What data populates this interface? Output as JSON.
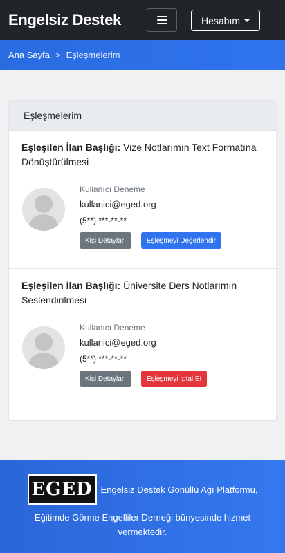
{
  "navbar": {
    "brand": "Engelsiz Destek",
    "menu_icon": "hamburger-icon",
    "account_label": "Hesabım",
    "account_icon": "caret-down-icon"
  },
  "breadcrumb": {
    "home": "Ana Sayfa",
    "separator": ">",
    "current": "Eşleşmelerim"
  },
  "card": {
    "header": "Eşleşmelerim",
    "matches": [
      {
        "title_label": "Eşleşilen İlan Başlığı:",
        "title_value": "Vize Notlarımın Text Formatına Dönüştürülmesi",
        "name": "Kullanıcı Deneme",
        "email": "kullanici@eged.org",
        "phone": "(5**) ***-**-**",
        "details_button": "Kişi Detayları",
        "action_button": "Eşleşmeyi Değerlendir",
        "action_color": "#2f74ee"
      },
      {
        "title_label": "Eşleşilen İlan Başlığı:",
        "title_value": "Üniversite Ders Notlarımın Seslendirilmesi",
        "name": "Kullanıcı Deneme",
        "email": "kullanici@eged.org",
        "phone": "(5**) ***-**-**",
        "details_button": "Kişi Detayları",
        "action_button": "Eşleşmeyi İptal Et",
        "action_color": "#e4353a"
      }
    ]
  },
  "footer": {
    "logo_text": "EGED",
    "line1": "Engelsiz Destek Gönüllü Ağı Platformu,",
    "line2": "Eğitimde Görme Engelliler Derneği bünyesinde hizmet vermektedir."
  },
  "colors": {
    "navbar_bg": "#212529",
    "accent_blue": "#2f74ee",
    "danger_red": "#e4353a",
    "secondary_gray": "#6c757d"
  }
}
